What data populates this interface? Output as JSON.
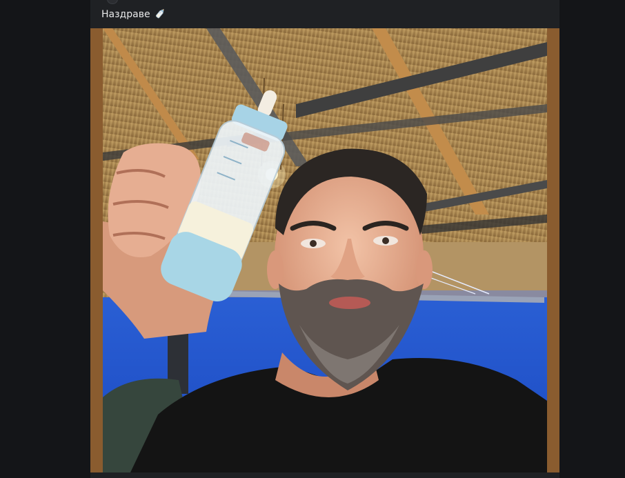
{
  "post": {
    "caption": "Наздраве",
    "caption_emoji": "baby-bottle-icon",
    "photo_alt": "",
    "colors": {
      "card_bg": "#1f2124",
      "page_bg": "#141518",
      "frame": "#8a5c2f",
      "caption_text": "#e8e9ea"
    }
  }
}
